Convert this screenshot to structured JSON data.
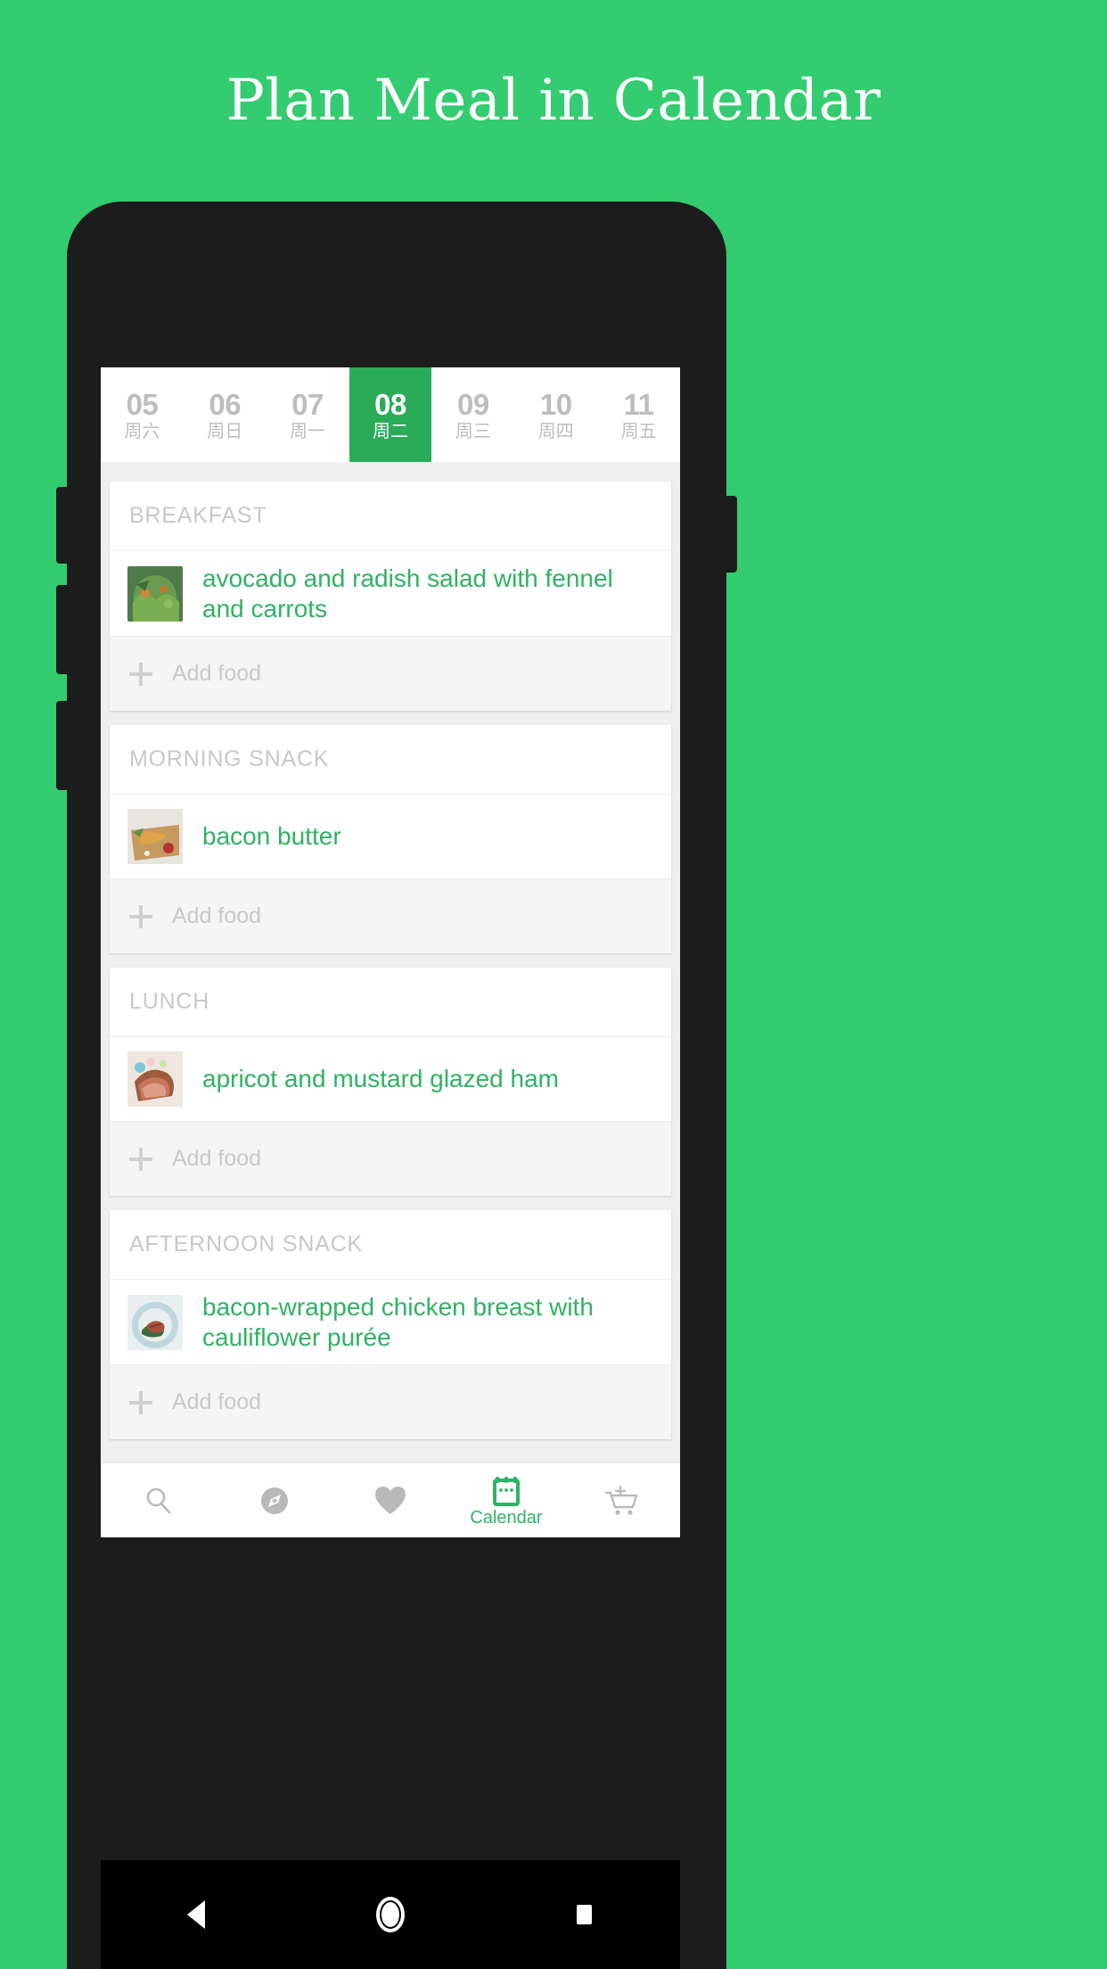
{
  "promo": {
    "title": "Plan Meal in Calendar"
  },
  "colors": {
    "background_green": "#33cc70",
    "selected_day_green": "#2aab58",
    "food_text_green": "#2fb264",
    "muted_gray": "#c8c8c8",
    "card_white": "#ffffff"
  },
  "date_strip": {
    "days": [
      {
        "num": "05",
        "weekday": "周六",
        "selected": false
      },
      {
        "num": "06",
        "weekday": "周日",
        "selected": false
      },
      {
        "num": "07",
        "weekday": "周一",
        "selected": false
      },
      {
        "num": "08",
        "weekday": "周二",
        "selected": true
      },
      {
        "num": "09",
        "weekday": "周三",
        "selected": false
      },
      {
        "num": "10",
        "weekday": "周四",
        "selected": false
      },
      {
        "num": "11",
        "weekday": "周五",
        "selected": false
      }
    ]
  },
  "meals": [
    {
      "header": "BREAKFAST",
      "foods": [
        {
          "name": "avocado and radish salad with fennel and carrots",
          "thumb": "salad-thumbnail"
        }
      ],
      "add_label": "Add food"
    },
    {
      "header": "MORNING SNACK",
      "foods": [
        {
          "name": "bacon butter",
          "thumb": "bacon-butter-thumbnail"
        }
      ],
      "add_label": "Add food"
    },
    {
      "header": "LUNCH",
      "foods": [
        {
          "name": "apricot and mustard glazed ham",
          "thumb": "glazed-ham-thumbnail"
        }
      ],
      "add_label": "Add food"
    },
    {
      "header": "AFTERNOON SNACK",
      "foods": [
        {
          "name": "bacon-wrapped chicken breast with cauliflower purée",
          "thumb": "chicken-breast-thumbnail"
        }
      ],
      "add_label": "Add food"
    }
  ],
  "bottom_nav": {
    "items": [
      {
        "icon": "search-icon",
        "label": "",
        "active": false
      },
      {
        "icon": "compass-icon",
        "label": "",
        "active": false
      },
      {
        "icon": "heart-icon",
        "label": "",
        "active": false
      },
      {
        "icon": "calendar-icon",
        "label": "Calendar",
        "active": true
      },
      {
        "icon": "cart-add-icon",
        "label": "",
        "active": false
      }
    ]
  },
  "system_bar": {
    "buttons": [
      {
        "icon": "back-triangle-icon"
      },
      {
        "icon": "home-circle-icon"
      },
      {
        "icon": "recents-square-icon"
      }
    ]
  }
}
